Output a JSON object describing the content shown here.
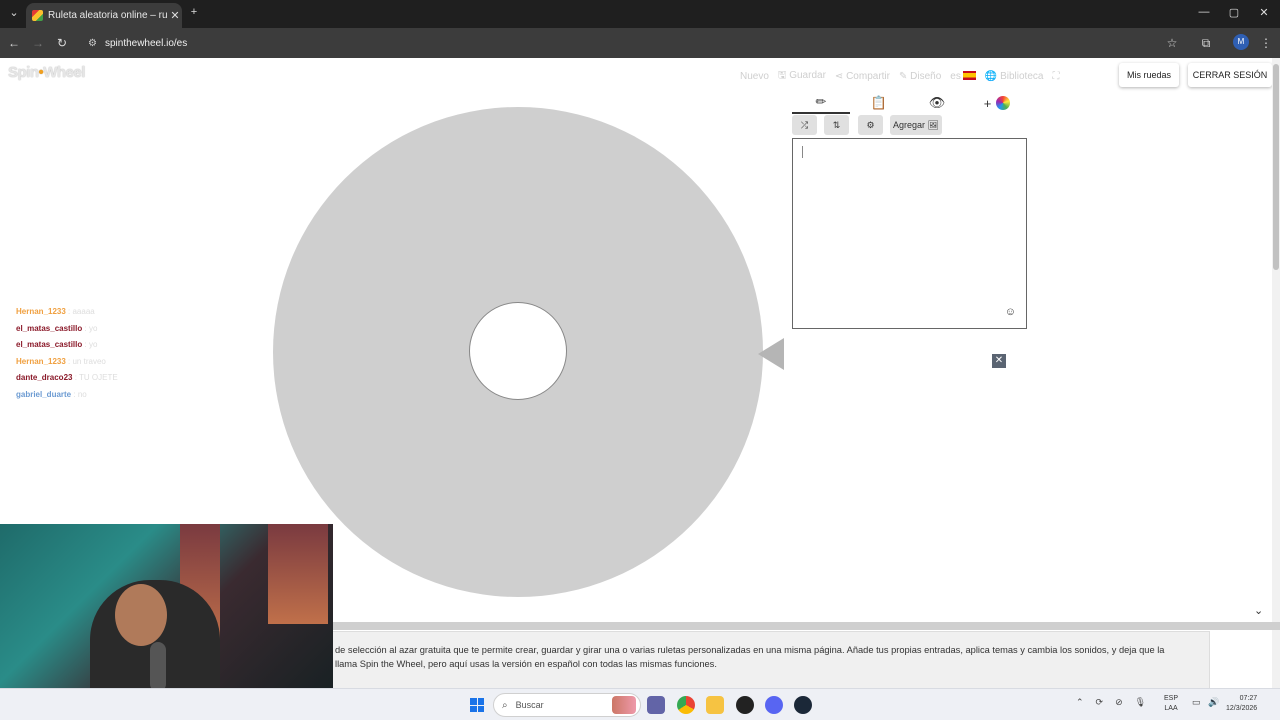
{
  "browser": {
    "tab_title": "Ruleta aleatoria online – ruleta",
    "url": "spinthewheel.io/es",
    "profile_initial": "M"
  },
  "header": {
    "logo_text_1": "Spin",
    "logo_text_2": "Wheel",
    "nav": {
      "nuevo": "Nuevo",
      "guardar": "Guardar",
      "compartir": "Compartir",
      "diseno": "Diseño",
      "lang": "es",
      "biblioteca": "Biblioteca"
    },
    "mis_ruedas": "Mis ruedas",
    "cerrar_sesion": "CERRAR SESIÓN"
  },
  "chat": [
    {
      "user": "Hernan_1233",
      "msg": "aaaaa",
      "color": "#f0a040"
    },
    {
      "user": "el_matas_castillo",
      "msg": "yo",
      "color": "#8b1a2a"
    },
    {
      "user": "el_matas_castillo",
      "msg": "yo",
      "color": "#8b1a2a"
    },
    {
      "user": "Hernan_1233",
      "msg": "un traveo",
      "color": "#f0a040"
    },
    {
      "user": "dante_draco23",
      "msg": "TU OJETE",
      "color": "#8b1a2a"
    },
    {
      "user": "gabriel_duarte",
      "msg": "no",
      "color": "#6c9bd2"
    }
  ],
  "panel": {
    "tab_icons": [
      "pencil-icon",
      "clipboard-icon",
      "eye-off-icon",
      "plus-icon"
    ],
    "tab_plus": "+",
    "agregar_label": "Agregar",
    "entries_value": ""
  },
  "footer": {
    "description_line1": "de selección al azar gratuita que te permite crear, guardar y girar una o varias ruletas personalizadas en una misma página. Añade tus propias entradas, aplica temas y cambia los sonidos, y deja que la",
    "description_line2": "llama Spin the Wheel, pero aquí usas la versión en español con todas las mismas funciones."
  },
  "taskbar": {
    "search_placeholder": "Buscar",
    "lang_line1": "ESP",
    "lang_line2": "LAA",
    "time": "07:27",
    "date": "12/3/2026"
  },
  "colors": {
    "wheel": "#cfcfcf",
    "pointer": "#b5b5b5",
    "accent": "#1a73e8"
  }
}
